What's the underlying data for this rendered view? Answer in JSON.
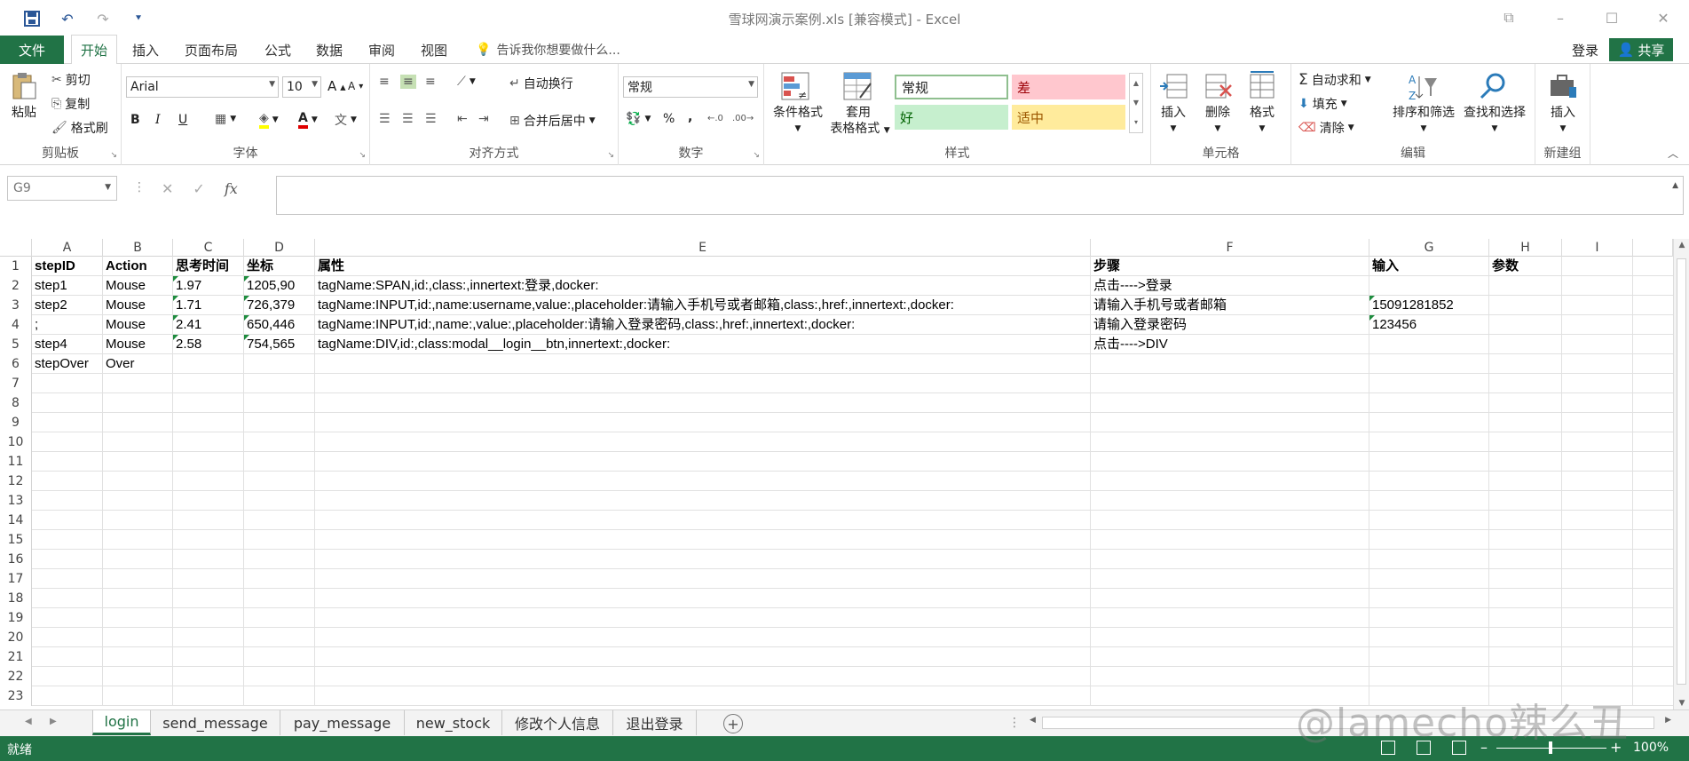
{
  "window": {
    "title": "雪球网演示案例.xls  [兼容模式] - Excel",
    "minimize": "–",
    "maximize": "☐",
    "close": "✕",
    "ribbon_display": "⧉"
  },
  "qat": {
    "save_icon": "save-icon",
    "undo_icon": "undo-icon",
    "redo_icon": "redo-icon",
    "customize_icon": "customize-icon"
  },
  "tabs": {
    "file": "文件",
    "items": [
      "开始",
      "插入",
      "页面布局",
      "公式",
      "数据",
      "审阅",
      "视图"
    ],
    "tell_me": "告诉我你想要做什么...",
    "login": "登录",
    "share": "共享"
  },
  "clipboard": {
    "paste": "粘贴",
    "cut": "剪切",
    "copy": "复制",
    "format_painter": "格式刷",
    "label": "剪贴板"
  },
  "font": {
    "name": "Arial",
    "size": "10",
    "label": "字体",
    "bold": "B",
    "italic": "I",
    "underline": "U",
    "grow": "A",
    "shrink": "A"
  },
  "alignment": {
    "wrap": "自动换行",
    "merge": "合并后居中",
    "label": "对齐方式"
  },
  "number": {
    "format": "常规",
    "percent": "%",
    "comma": ",",
    "label": "数字"
  },
  "styles": {
    "conditional": "条件格式",
    "table_format_1": "套用",
    "table_format_2": "表格格式",
    "normal": "常规",
    "bad": "差",
    "good": "好",
    "neutral": "适中",
    "label": "样式",
    "colors": {
      "normal_bg": "#ffffff",
      "bad_bg": "#ffc7ce",
      "bad_fg": "#9c0006",
      "good_bg": "#c6efce",
      "good_fg": "#006100",
      "neutral_bg": "#ffeb9c",
      "neutral_fg": "#9c5700"
    }
  },
  "cells": {
    "insert": "插入",
    "delete": "删除",
    "format": "格式",
    "label": "单元格"
  },
  "editing": {
    "autosum": "自动求和",
    "fill": "填充",
    "clear": "清除",
    "sort": "排序和筛选",
    "find": "查找和选择",
    "label": "编辑"
  },
  "newgroup": {
    "insert": "插入",
    "label": "新建组"
  },
  "formula": {
    "namebox": "G9",
    "cancel": "✕",
    "enter": "✓",
    "fx": "fx",
    "value": ""
  },
  "grid": {
    "columns": [
      "A",
      "B",
      "C",
      "D",
      "E",
      "F",
      "G",
      "H",
      "I"
    ],
    "row_numbers": [
      "1",
      "2",
      "3",
      "4",
      "5",
      "6",
      "7",
      "8",
      "9",
      "10",
      "11",
      "12",
      "13",
      "14",
      "15",
      "16",
      "17",
      "18",
      "19",
      "20",
      "21",
      "22",
      "23"
    ],
    "rows": [
      [
        "stepID",
        "Action",
        "思考时间",
        "坐标",
        "属性",
        "步骤",
        "输入",
        "参数",
        ""
      ],
      [
        "step1",
        "Mouse",
        "1.97",
        "1205,90",
        "tagName:SPAN,id:,class:,innertext:登录,docker:",
        "点击---->登录",
        "",
        "",
        ""
      ],
      [
        "step2",
        "Mouse",
        "1.71",
        "726,379",
        "tagName:INPUT,id:,name:username,value:,placeholder:请输入手机号或者邮箱,class:,href:,innertext:,docker:",
        "请输入手机号或者邮箱",
        "15091281852",
        "",
        ""
      ],
      [
        ";",
        "Mouse",
        "2.41",
        "650,446",
        "tagName:INPUT,id:,name:,value:,placeholder:请输入登录密码,class:,href:,innertext:,docker:",
        "请输入登录密码",
        "123456",
        "",
        ""
      ],
      [
        "step4",
        "Mouse",
        "2.58",
        "754,565",
        "tagName:DIV,id:,class:modal__login__btn,innertext:,docker:",
        "点击---->DIV",
        "",
        "",
        ""
      ],
      [
        "stepOver",
        "Over",
        "",
        "",
        "",
        "",
        "",
        "",
        ""
      ]
    ]
  },
  "sheets": [
    "login",
    "send_message",
    "pay_message",
    "new_stock",
    "修改个人信息",
    "退出登录"
  ],
  "status": {
    "text": "就绪",
    "zoom": "100%",
    "minus": "–",
    "plus": "+"
  },
  "watermark": "@lamecho辣么丑",
  "accent": "#217346"
}
